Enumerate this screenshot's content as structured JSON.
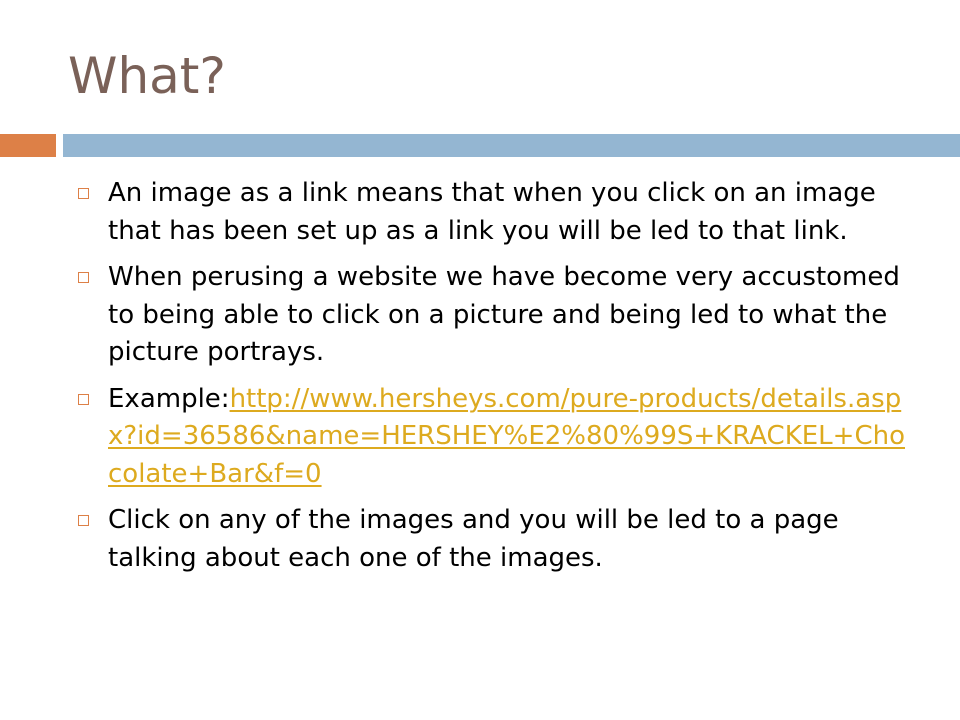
{
  "slide": {
    "title": "What?",
    "bullets": [
      {
        "text": "An image as a link means that when you click on an image that has been set up as a link you will be led to that link."
      },
      {
        "text": "When perusing a website we have become very accustomed to being able to click on a picture and being led to what the picture portrays."
      },
      {
        "prefix": "Example:",
        "link_text": "http://www.hersheys.com/pure-products/details.aspx?id=36586&name=HERSHEY%E2%80%99S+KRACKEL+Chocolate+Bar&f=0"
      },
      {
        "text": "Click on any of the images and you will be led to a page talking about each one of the images."
      }
    ]
  },
  "colors": {
    "title": "#7a6158",
    "accent_orange": "#dd8047",
    "accent_blue": "#94b6d2",
    "link": "#ddaa1f",
    "bullet_marker": "#dd8047"
  },
  "icons": {
    "bullet": "hollow-square-bullet-icon"
  }
}
